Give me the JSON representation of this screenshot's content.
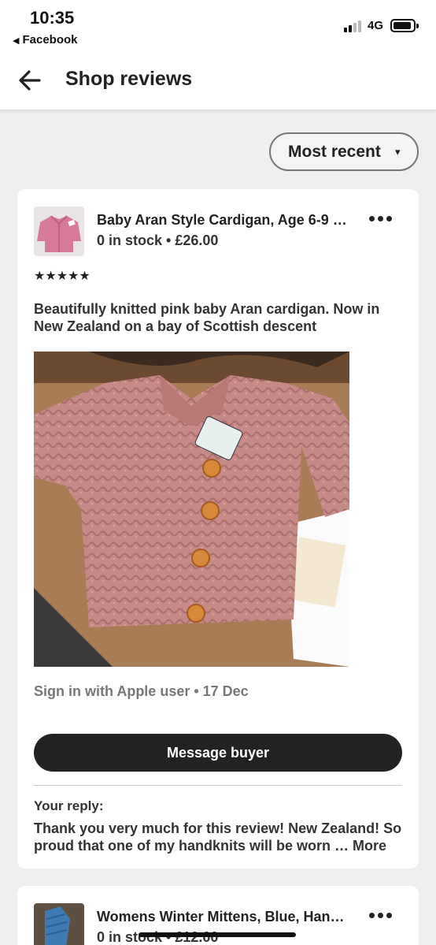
{
  "status_bar": {
    "time": "10:35",
    "back_app": "Facebook",
    "network": "4G"
  },
  "app_bar": {
    "title": "Shop reviews",
    "back_icon": "arrow-left-icon"
  },
  "sort": {
    "label": "Most recent",
    "caret": "▾"
  },
  "reviews": [
    {
      "item_title": "Baby Aran Style Cardigan, Age 6-9 …",
      "item_meta": "0 in stock • £26.00",
      "rating": 5,
      "stars": "★★★★★",
      "text": "Beautifully knitted pink baby Aran cardigan. Now in New Zealand on a bay of Scottish descent",
      "reviewer": "Sign in with Apple user • 17 Dec",
      "message_button": "Message buyer",
      "reply_label": "Your reply:",
      "reply_text": "Thank you very much for this review! New Zealand! So proud that one of my handknits will be worn  …",
      "reply_more": "More"
    },
    {
      "item_title": "Womens Winter Mittens, Blue, Han…",
      "item_meta": "0 in stock • £12.00"
    }
  ],
  "colors": {
    "background": "#efefef",
    "card": "#ffffff",
    "button": "#222222",
    "text": "#222222",
    "muted": "#777777"
  }
}
